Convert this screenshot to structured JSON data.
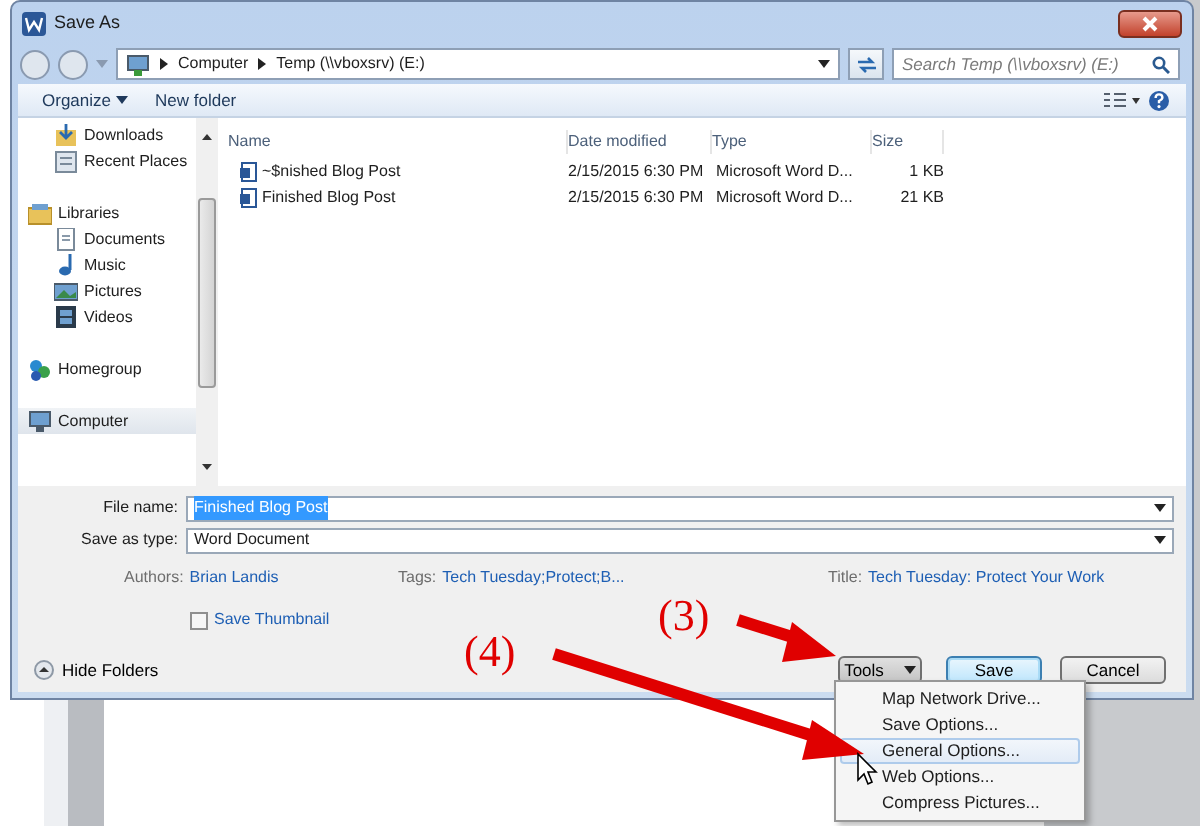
{
  "window": {
    "title": "Save As"
  },
  "address": {
    "path": [
      "Computer",
      "Temp (\\\\vboxsrv) (E:)"
    ]
  },
  "search": {
    "placeholder": "Search Temp (\\\\vboxsrv) (E:)"
  },
  "toolbar": {
    "buttons": [
      {
        "label": "Organize",
        "dropdown": true
      },
      {
        "label": "New folder",
        "dropdown": false
      }
    ]
  },
  "sidebar": {
    "items": [
      {
        "label": "Downloads",
        "kind": "downloads",
        "selected": false
      },
      {
        "label": "Recent Places",
        "kind": "recent",
        "selected": false
      },
      {
        "label": "Libraries",
        "kind": "libraries",
        "selected": false,
        "children": [
          {
            "label": "Documents",
            "kind": "documents",
            "selected": false
          },
          {
            "label": "Music",
            "kind": "music",
            "selected": false
          },
          {
            "label": "Pictures",
            "kind": "pictures",
            "selected": false
          },
          {
            "label": "Videos",
            "kind": "videos",
            "selected": false
          }
        ]
      },
      {
        "label": "Homegroup",
        "kind": "homegroup",
        "selected": false
      },
      {
        "label": "Computer",
        "kind": "computer",
        "selected": true
      }
    ]
  },
  "table": {
    "columns": [
      "Name",
      "Date modified",
      "Type",
      "Size"
    ],
    "rows": [
      {
        "cells": [
          "~$nished Blog Post",
          "2/15/2015 6:30 PM",
          "Microsoft Word D...",
          "1 KB"
        ]
      },
      {
        "cells": [
          "Finished Blog Post",
          "2/15/2015 6:30 PM",
          "Microsoft Word D...",
          "21 KB"
        ]
      }
    ]
  },
  "file_name": {
    "label": "File name:",
    "value": "Finished Blog Post"
  },
  "save_as_type": {
    "label": "Save as type:",
    "value": "Word Document"
  },
  "metadata": [
    {
      "label": "Authors:",
      "value": "Brian Landis"
    },
    {
      "label": "Tags:",
      "value": "Tech Tuesday;Protect;B..."
    },
    {
      "label": "Title:",
      "value": "Tech Tuesday: Protect Your Work"
    }
  ],
  "save_thumbnail": {
    "label": "Save Thumbnail",
    "checked": false
  },
  "hide_folders": {
    "label": "Hide Folders"
  },
  "buttons": [
    {
      "label": "Tools",
      "kind": "dropdown"
    },
    {
      "label": "Save",
      "kind": "default"
    },
    {
      "label": "Cancel",
      "kind": "plain"
    }
  ],
  "tools_menu": {
    "items": [
      {
        "label": "Map Network Drive...",
        "selected": false
      },
      {
        "label": "Save Options...",
        "selected": false
      },
      {
        "label": "General Options...",
        "selected": true
      },
      {
        "label": "Web Options...",
        "selected": false
      },
      {
        "label": "Compress Pictures...",
        "selected": false
      }
    ]
  },
  "annotations": [
    {
      "label": "(3)"
    },
    {
      "label": "(4)"
    }
  ]
}
